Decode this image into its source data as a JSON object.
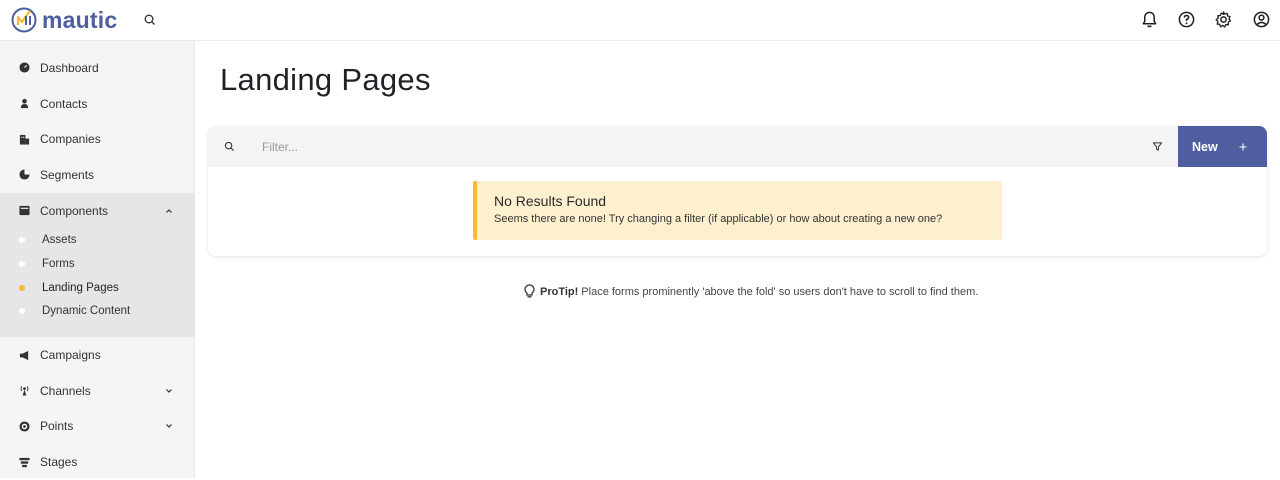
{
  "brand": {
    "name": "mautic",
    "color": "#4e5e9e",
    "accent": "#fdb933"
  },
  "sidebar": {
    "items": [
      {
        "label": "Dashboard",
        "icon": "speedometer-icon"
      },
      {
        "label": "Contacts",
        "icon": "person-icon"
      },
      {
        "label": "Companies",
        "icon": "building-icon"
      },
      {
        "label": "Segments",
        "icon": "pie-chart-icon"
      },
      {
        "label": "Components",
        "icon": "archive-icon",
        "expanded": true,
        "children": [
          {
            "label": "Assets"
          },
          {
            "label": "Forms"
          },
          {
            "label": "Landing Pages",
            "active": true
          },
          {
            "label": "Dynamic Content"
          }
        ]
      },
      {
        "label": "Campaigns",
        "icon": "megaphone-icon"
      },
      {
        "label": "Channels",
        "icon": "broadcast-icon"
      },
      {
        "label": "Points",
        "icon": "target-icon"
      },
      {
        "label": "Stages",
        "icon": "filter-stack-icon"
      }
    ]
  },
  "topbar": {
    "icons": [
      "notification-bell-icon",
      "help-icon",
      "settings-gear-icon",
      "user-account-icon"
    ]
  },
  "main": {
    "title": "Landing Pages",
    "filter": {
      "placeholder": "Filter...",
      "value": ""
    },
    "new_button": {
      "label": "New"
    },
    "alert": {
      "title": "No Results Found",
      "text": "Seems there are none! Try changing a filter (if applicable) or how about creating a new one?"
    },
    "protip": {
      "label": "ProTip!",
      "text": "Place forms prominently 'above the fold' so users don't have to scroll to find them."
    }
  }
}
